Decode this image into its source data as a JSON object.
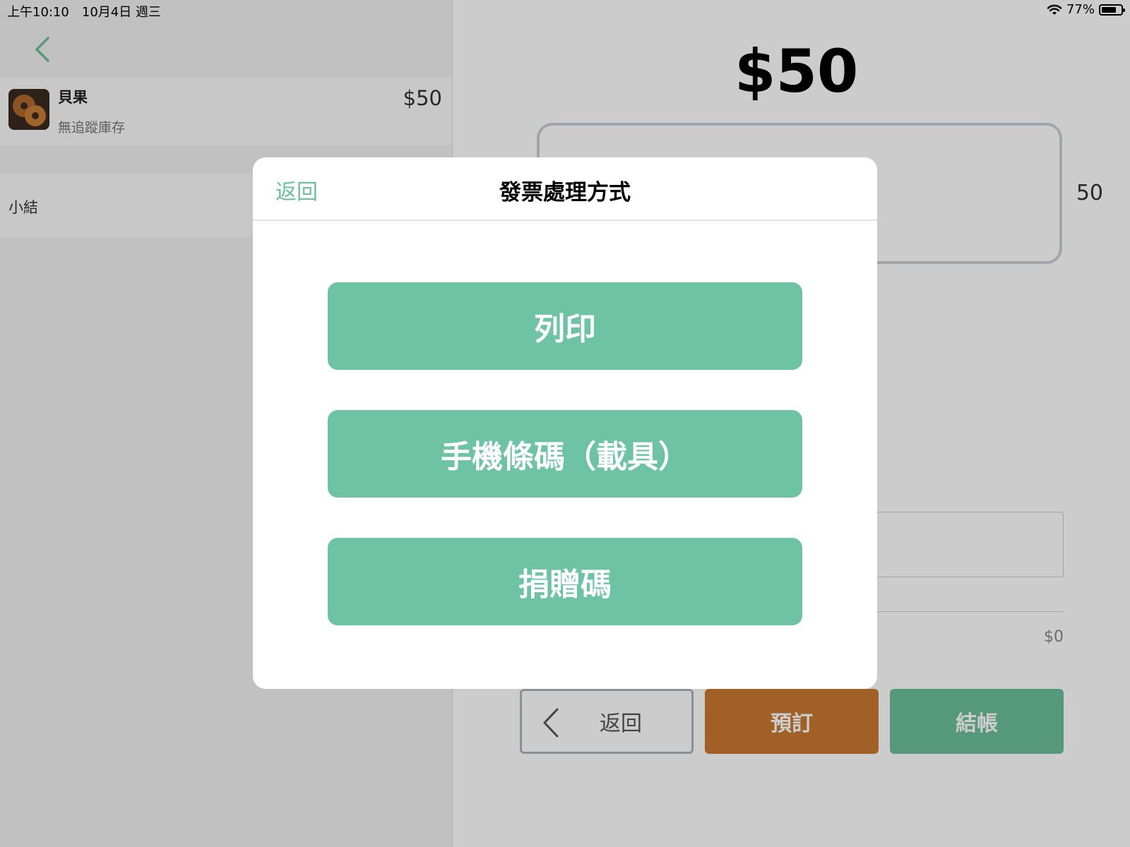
{
  "status_bar": {
    "time_date": "上午10:10　10月4日 週三",
    "battery_percent": "77%",
    "battery_level": 0.77
  },
  "order": {
    "items": [
      {
        "name": "貝果",
        "subtitle": "無追蹤庫存",
        "price": "$50"
      }
    ],
    "subtotal_label": "小結"
  },
  "payment": {
    "total": "$50",
    "input_value": "50",
    "change": "$0",
    "buttons": {
      "back": "返回",
      "reserve": "預訂",
      "checkout": "結帳"
    }
  },
  "modal": {
    "back_label": "返回",
    "title": "發票處理方式",
    "options": [
      "列印",
      "手機條碼（載具）",
      "捐贈碼"
    ]
  },
  "colors": {
    "accent_green": "#6cbf9c",
    "option_green": "#6ec3a5",
    "reserve_orange": "#c97930"
  }
}
